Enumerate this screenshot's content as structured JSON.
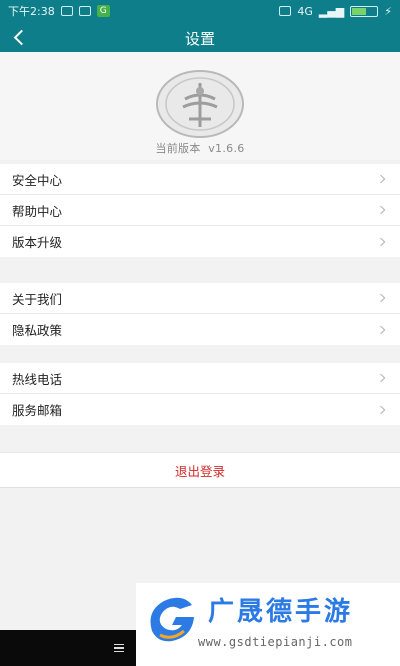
{
  "status_bar": {
    "time": "下午2:38",
    "badge": "G",
    "network": "4G",
    "battery_level": 0.6
  },
  "header": {
    "back_icon": "chevron-left-icon",
    "title": "设置"
  },
  "app_info": {
    "emblem_icon": "emblem-logo",
    "version_label": "当前版本",
    "version": "v1.6.6"
  },
  "menu_groups": [
    {
      "items": [
        {
          "label": "安全中心"
        },
        {
          "label": "帮助中心"
        },
        {
          "label": "版本升级"
        }
      ]
    },
    {
      "items": [
        {
          "label": "关于我们"
        },
        {
          "label": "隐私政策"
        }
      ]
    },
    {
      "items": [
        {
          "label": "热线电话"
        },
        {
          "label": "服务邮箱"
        }
      ]
    }
  ],
  "logout": {
    "label": "退出登录"
  },
  "watermark": {
    "name": "广晟德手游",
    "url": "www.gsdtiepianji.com"
  },
  "colors": {
    "primary": "#0e7f8a",
    "logout_text": "#d22a2a",
    "watermark_blue": "#2c7be5"
  }
}
